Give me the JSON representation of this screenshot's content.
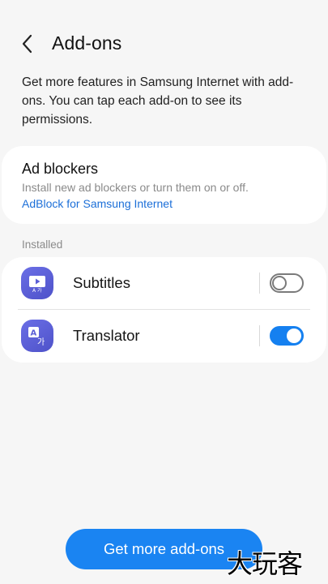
{
  "header": {
    "title": "Add-ons",
    "back_icon": "chevron-left-icon"
  },
  "description": "Get more features in Samsung Internet with add-ons. You can tap each add-on to see its permissions.",
  "ad_blockers": {
    "title": "Ad blockers",
    "subtitle": "Install new ad blockers or turn them on or off.",
    "link": "AdBlock for Samsung Internet"
  },
  "installed": {
    "section_label": "Installed",
    "items": [
      {
        "name": "Subtitles",
        "icon": "subtitles-icon",
        "enabled": false
      },
      {
        "name": "Translator",
        "icon": "translator-icon",
        "enabled": true
      }
    ]
  },
  "cta": {
    "label": "Get more add-ons"
  },
  "watermark": "大玩客",
  "colors": {
    "accent": "#1a84f2",
    "link": "#1c6fd8",
    "icon_bg": "#5a5ed6",
    "background": "#f6f6f6"
  }
}
